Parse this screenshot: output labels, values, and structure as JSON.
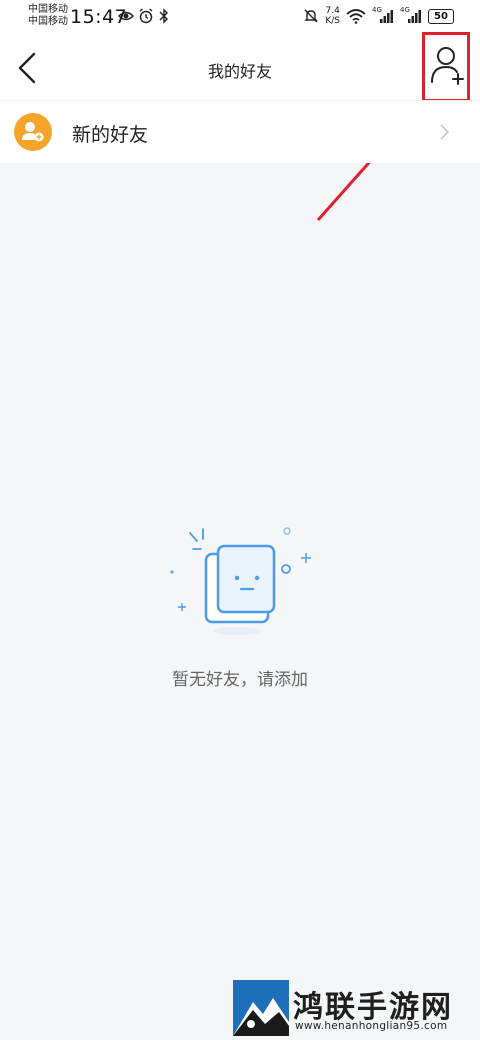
{
  "status_bar": {
    "carrier_1": "中国移动",
    "carrier_2": "中国移动",
    "time": "15:47",
    "net_speed_value": "7.4",
    "net_speed_unit": "K/S",
    "signal_1_label": "4G",
    "signal_2_label": "4G",
    "battery": "50"
  },
  "navbar": {
    "title": "我的好友"
  },
  "list": {
    "new_friends_label": "新的好友"
  },
  "empty_state": {
    "message": "暂无好友，请添加"
  },
  "watermark": {
    "name": "鸿联手游网",
    "url": "www.henanhonglian95.com"
  },
  "colors": {
    "accent_orange": "#f5a32a",
    "highlight_red": "#e0202a",
    "illustration_blue": "#4a9be8"
  }
}
